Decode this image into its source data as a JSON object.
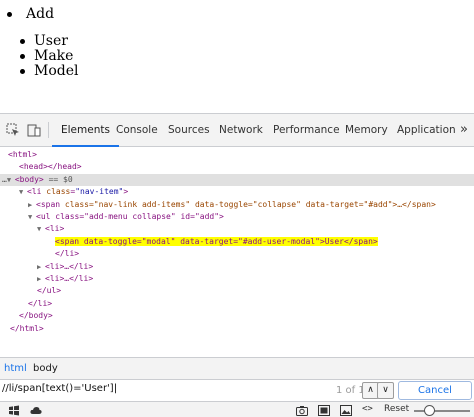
{
  "page": {
    "top_item": "Add",
    "sub_items": [
      "User",
      "Make",
      "Model"
    ]
  },
  "devtools": {
    "tabs": [
      "Elements",
      "Console",
      "Sources",
      "Network",
      "Performance",
      "Memory",
      "Application"
    ],
    "active_tab": "Elements",
    "dom": {
      "html_open": "<html>",
      "head": "<head></head>",
      "body_open": "<body>",
      "body_eq": "== $0",
      "li_tag": "<li ",
      "li_attr": "class",
      "li_val": "\"nav-item\"",
      "span1_a": "<span ",
      "span1_text": "class=\"nav-link add-items\" data-toggle=\"collapse\" data-target=\"#add\">…</span>",
      "ul_text": "<ul class=\"add-menu collapse\" id=\"add\">",
      "li2_open": "<li>",
      "span2_text": "<span data-toggle=\"modal\" data-target=\"#add-user-modal\">User</span>",
      "li2_close": "</li>",
      "li3": "<li>…</li>",
      "li4": "<li>…</li>",
      "ul_close": "</ul>",
      "li_close": "</li>",
      "body_close": "</body>",
      "html_close": "</html>"
    },
    "breadcrumbs": [
      "html",
      "body"
    ],
    "search": {
      "value": "//li/span[text()='User']",
      "count": "1 of 1",
      "cancel_label": "Cancel"
    },
    "bottom": {
      "reset_label": "Reset"
    }
  }
}
